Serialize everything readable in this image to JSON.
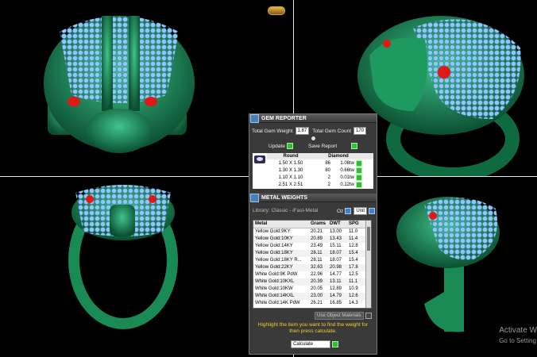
{
  "gem_reporter": {
    "title": "GEM REPORTER",
    "total_gem_weight_label": "Total Gem Weight",
    "total_gem_weight": "1.87",
    "total_gem_count_label": "Total Gem Count",
    "total_gem_count": "170",
    "update_label": "Update",
    "save_report_label": "Save Report",
    "columns": [
      "Round",
      "Diamond"
    ],
    "rows": [
      {
        "size": "1.50 X 1.50",
        "count": "86",
        "weight": "1.08tw"
      },
      {
        "size": "1.30 X 1.30",
        "count": "80",
        "weight": "0.66tw"
      },
      {
        "size": "1.10 X 1.10",
        "count": "2",
        "weight": "0.01tw"
      },
      {
        "size": "2.51 X 2.51",
        "count": "2",
        "weight": "0.12tw"
      }
    ]
  },
  "metal_weights": {
    "title": "METAL WEIGHTS",
    "library": "Library: Classic - iFast-Metal",
    "oz_label": "Oz",
    "unit_label": "Unit",
    "headers": [
      "Metal",
      "Grams",
      "DWT",
      "SPG"
    ],
    "rows": [
      {
        "metal": "Yellow Gold:9KY",
        "grams": "20.21",
        "dwt": "13.00",
        "spg": "11.0"
      },
      {
        "metal": "Yellow Gold:10KY",
        "grams": "20.89",
        "dwt": "13.43",
        "spg": "11.4"
      },
      {
        "metal": "Yellow Gold:14KY",
        "grams": "23.49",
        "dwt": "15.11",
        "spg": "12.8"
      },
      {
        "metal": "Yellow Gold:18KY",
        "grams": "28.11",
        "dwt": "18.07",
        "spg": "15.4"
      },
      {
        "metal": "Yellow Gold:18KY R...",
        "grams": "28.11",
        "dwt": "18.07",
        "spg": "15.4"
      },
      {
        "metal": "Yellow Gold:22KY",
        "grams": "32.63",
        "dwt": "20.98",
        "spg": "17.8"
      },
      {
        "metal": "White Gold:9K PdW",
        "grams": "22.96",
        "dwt": "14.77",
        "spg": "12.5"
      },
      {
        "metal": "White Gold:10KXL",
        "grams": "20.39",
        "dwt": "13.11",
        "spg": "11.1"
      },
      {
        "metal": "White Gold:10KW",
        "grams": "20.05",
        "dwt": "12.89",
        "spg": "10.9"
      },
      {
        "metal": "White Gold:14KXL",
        "grams": "23.00",
        "dwt": "14.79",
        "spg": "12.6"
      },
      {
        "metal": "White Gold:14K PdW",
        "grams": "26.21",
        "dwt": "16.85",
        "spg": "14.3"
      }
    ],
    "use_object_materials": "Use Object Materials",
    "hint": "Highlight the item you want to find the weight for then press calculate.",
    "calculate_label": "Calculate"
  },
  "watermark": {
    "line1": "Activate W",
    "line2": "Go to Setting"
  },
  "colors": {
    "ring_green": "#1a8a55",
    "gem_blue": "#8ec9f2",
    "eye_red": "#e01818",
    "hint_yellow": "#f2d02a",
    "ok_green": "#3bb53b"
  }
}
